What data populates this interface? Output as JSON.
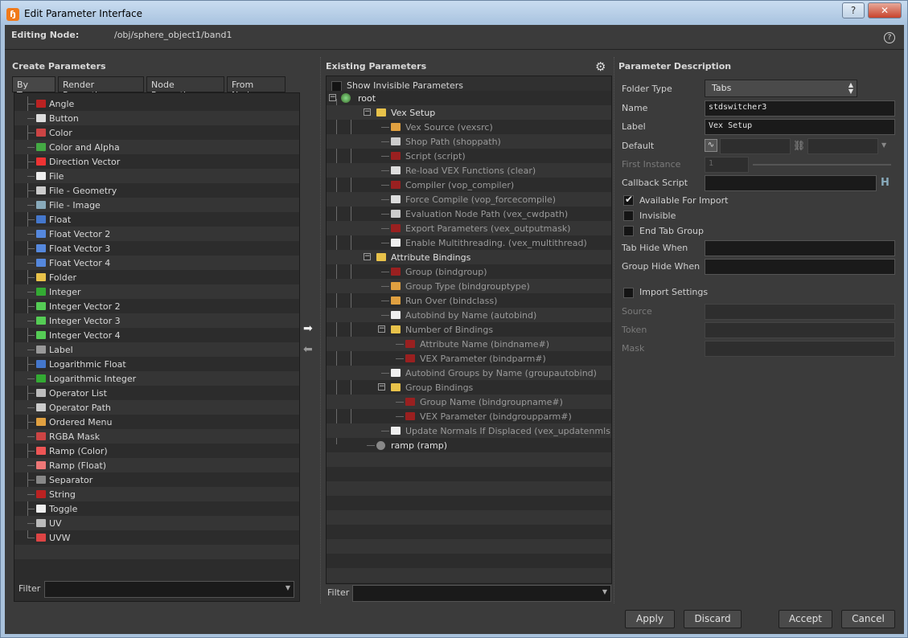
{
  "window": {
    "title": "Edit Parameter Interface",
    "help_glyph": "?",
    "close_glyph": "✕"
  },
  "header": {
    "editing_label": "Editing Node:",
    "editing_path": "/obj/sphere_object1/band1",
    "help_icon": "?"
  },
  "create": {
    "title": "Create Parameters",
    "tabs": [
      "By Type",
      "Render Properties",
      "Node Properties",
      "From Nodes"
    ],
    "items": [
      {
        "label": "Angle",
        "icon": "angle-icon",
        "color": "#b22"
      },
      {
        "label": "Button",
        "icon": "button-icon",
        "color": "#ddd"
      },
      {
        "label": "Color",
        "icon": "color-icon",
        "color": "#c44"
      },
      {
        "label": "Color and Alpha",
        "icon": "color-alpha-icon",
        "color": "#4a4"
      },
      {
        "label": "Direction Vector",
        "icon": "direction-vector-icon",
        "color": "#e33"
      },
      {
        "label": "File",
        "icon": "file-icon",
        "color": "#eee"
      },
      {
        "label": "File - Geometry",
        "icon": "file-geometry-icon",
        "color": "#ccc"
      },
      {
        "label": "File - Image",
        "icon": "file-image-icon",
        "color": "#8ab"
      },
      {
        "label": "Float",
        "icon": "float-icon",
        "color": "#47c"
      },
      {
        "label": "Float Vector 2",
        "icon": "float-vector2-icon",
        "color": "#58d"
      },
      {
        "label": "Float Vector 3",
        "icon": "float-vector3-icon",
        "color": "#58d"
      },
      {
        "label": "Float Vector 4",
        "icon": "float-vector4-icon",
        "color": "#58d"
      },
      {
        "label": "Folder",
        "icon": "folder-icon",
        "color": "#e8c24a"
      },
      {
        "label": "Integer",
        "icon": "integer-icon",
        "color": "#3a3"
      },
      {
        "label": "Integer Vector 2",
        "icon": "integer-vector2-icon",
        "color": "#5c5"
      },
      {
        "label": "Integer Vector 3",
        "icon": "integer-vector3-icon",
        "color": "#5c5"
      },
      {
        "label": "Integer Vector 4",
        "icon": "integer-vector4-icon",
        "color": "#5c5"
      },
      {
        "label": "Label",
        "icon": "label-icon",
        "color": "#999"
      },
      {
        "label": "Logarithmic Float",
        "icon": "log-float-icon",
        "color": "#47c"
      },
      {
        "label": "Logarithmic Integer",
        "icon": "log-integer-icon",
        "color": "#3a3"
      },
      {
        "label": "Operator List",
        "icon": "operator-list-icon",
        "color": "#bbb"
      },
      {
        "label": "Operator Path",
        "icon": "operator-path-icon",
        "color": "#ccc"
      },
      {
        "label": "Ordered Menu",
        "icon": "ordered-menu-icon",
        "color": "#e0a040"
      },
      {
        "label": "RGBA Mask",
        "icon": "rgba-mask-icon",
        "color": "#c44"
      },
      {
        "label": "Ramp (Color)",
        "icon": "ramp-color-icon",
        "color": "#e55"
      },
      {
        "label": "Ramp (Float)",
        "icon": "ramp-float-icon",
        "color": "#e77"
      },
      {
        "label": "Separator",
        "icon": "separator-icon",
        "color": "#888"
      },
      {
        "label": "String",
        "icon": "string-icon",
        "color": "#b22"
      },
      {
        "label": "Toggle",
        "icon": "toggle-icon",
        "color": "#eee"
      },
      {
        "label": "UV",
        "icon": "uv-icon",
        "color": "#bbb"
      },
      {
        "label": "UVW",
        "icon": "uvw-icon",
        "color": "#d44"
      }
    ],
    "filter_label": "Filter",
    "filter_value": ""
  },
  "existing": {
    "title": "Existing Parameters",
    "show_invisible": "Show Invisible Parameters",
    "root": "root",
    "tree": [
      {
        "label": "Vex Setup",
        "icon": "folder-icon",
        "depth": 1,
        "expand": "−",
        "dim": false
      },
      {
        "label": "Vex Source (vexsrc)",
        "icon": "ordered-menu-icon",
        "depth": 2,
        "dim": true
      },
      {
        "label": "Shop Path (shoppath)",
        "icon": "operator-path-icon",
        "depth": 2,
        "dim": true
      },
      {
        "label": "Script (script)",
        "icon": "string-icon",
        "depth": 2,
        "dim": true
      },
      {
        "label": "Re-load VEX Functions (clear)",
        "icon": "button-icon",
        "depth": 2,
        "dim": true
      },
      {
        "label": "Compiler (vop_compiler)",
        "icon": "string-icon",
        "depth": 2,
        "dim": true
      },
      {
        "label": "Force Compile (vop_forcecompile)",
        "icon": "button-icon",
        "depth": 2,
        "dim": true
      },
      {
        "label": "Evaluation Node Path (vex_cwdpath)",
        "icon": "operator-path-icon",
        "depth": 2,
        "dim": true
      },
      {
        "label": "Export Parameters (vex_outputmask)",
        "icon": "string-icon",
        "depth": 2,
        "dim": true
      },
      {
        "label": "Enable Multithreading. (vex_multithread)",
        "icon": "toggle-icon",
        "depth": 2,
        "dim": true
      },
      {
        "label": "Attribute Bindings",
        "icon": "folder-icon",
        "depth": 1,
        "expand": "−",
        "dim": false
      },
      {
        "label": "Group (bindgroup)",
        "icon": "string-icon",
        "depth": 2,
        "dim": true
      },
      {
        "label": "Group Type (bindgrouptype)",
        "icon": "ordered-menu-icon",
        "depth": 2,
        "dim": true
      },
      {
        "label": "Run Over (bindclass)",
        "icon": "ordered-menu-icon",
        "depth": 2,
        "dim": true
      },
      {
        "label": "Autobind by Name (autobind)",
        "icon": "toggle-icon",
        "depth": 2,
        "dim": true
      },
      {
        "label": "Number of Bindings",
        "icon": "folder-icon",
        "depth": 2,
        "expand": "−",
        "dim": true
      },
      {
        "label": "Attribute Name (bindname#)",
        "icon": "string-icon",
        "depth": 3,
        "dim": true
      },
      {
        "label": "VEX Parameter (bindparm#)",
        "icon": "string-icon",
        "depth": 3,
        "dim": true
      },
      {
        "label": "Autobind Groups by Name (groupautobind)",
        "icon": "toggle-icon",
        "depth": 2,
        "dim": true
      },
      {
        "label": "Group Bindings",
        "icon": "folder-icon",
        "depth": 2,
        "expand": "−",
        "dim": true
      },
      {
        "label": "Group Name (bindgroupname#)",
        "icon": "string-icon",
        "depth": 3,
        "dim": true
      },
      {
        "label": "VEX Parameter (bindgroupparm#)",
        "icon": "string-icon",
        "depth": 3,
        "dim": true
      },
      {
        "label": "Update Normals If Displaced (vex_updatenmls)",
        "icon": "toggle-icon",
        "depth": 2,
        "dim": true
      },
      {
        "label": "ramp (ramp)",
        "icon": "ramp-icon",
        "depth": 1,
        "dim": false
      }
    ],
    "filter_label": "Filter"
  },
  "desc": {
    "title": "Parameter Description",
    "folder_type_label": "Folder Type",
    "folder_type_value": "Tabs",
    "name_label": "Name",
    "name_value": "stdswitcher3",
    "label_label": "Label",
    "label_value": "Vex Setup",
    "default_label": "Default",
    "first_instance_label": "First Instance",
    "first_instance_value": "1",
    "callback_label": "Callback Script",
    "available_label": "Available For Import",
    "invisible_label": "Invisible",
    "endtab_label": "End Tab Group",
    "tabhide_label": "Tab Hide When",
    "grouphide_label": "Group Hide When",
    "import_label": "Import Settings",
    "source_label": "Source",
    "token_label": "Token",
    "mask_label": "Mask"
  },
  "buttons": {
    "apply": "Apply",
    "discard": "Discard",
    "accept": "Accept",
    "cancel": "Cancel"
  }
}
